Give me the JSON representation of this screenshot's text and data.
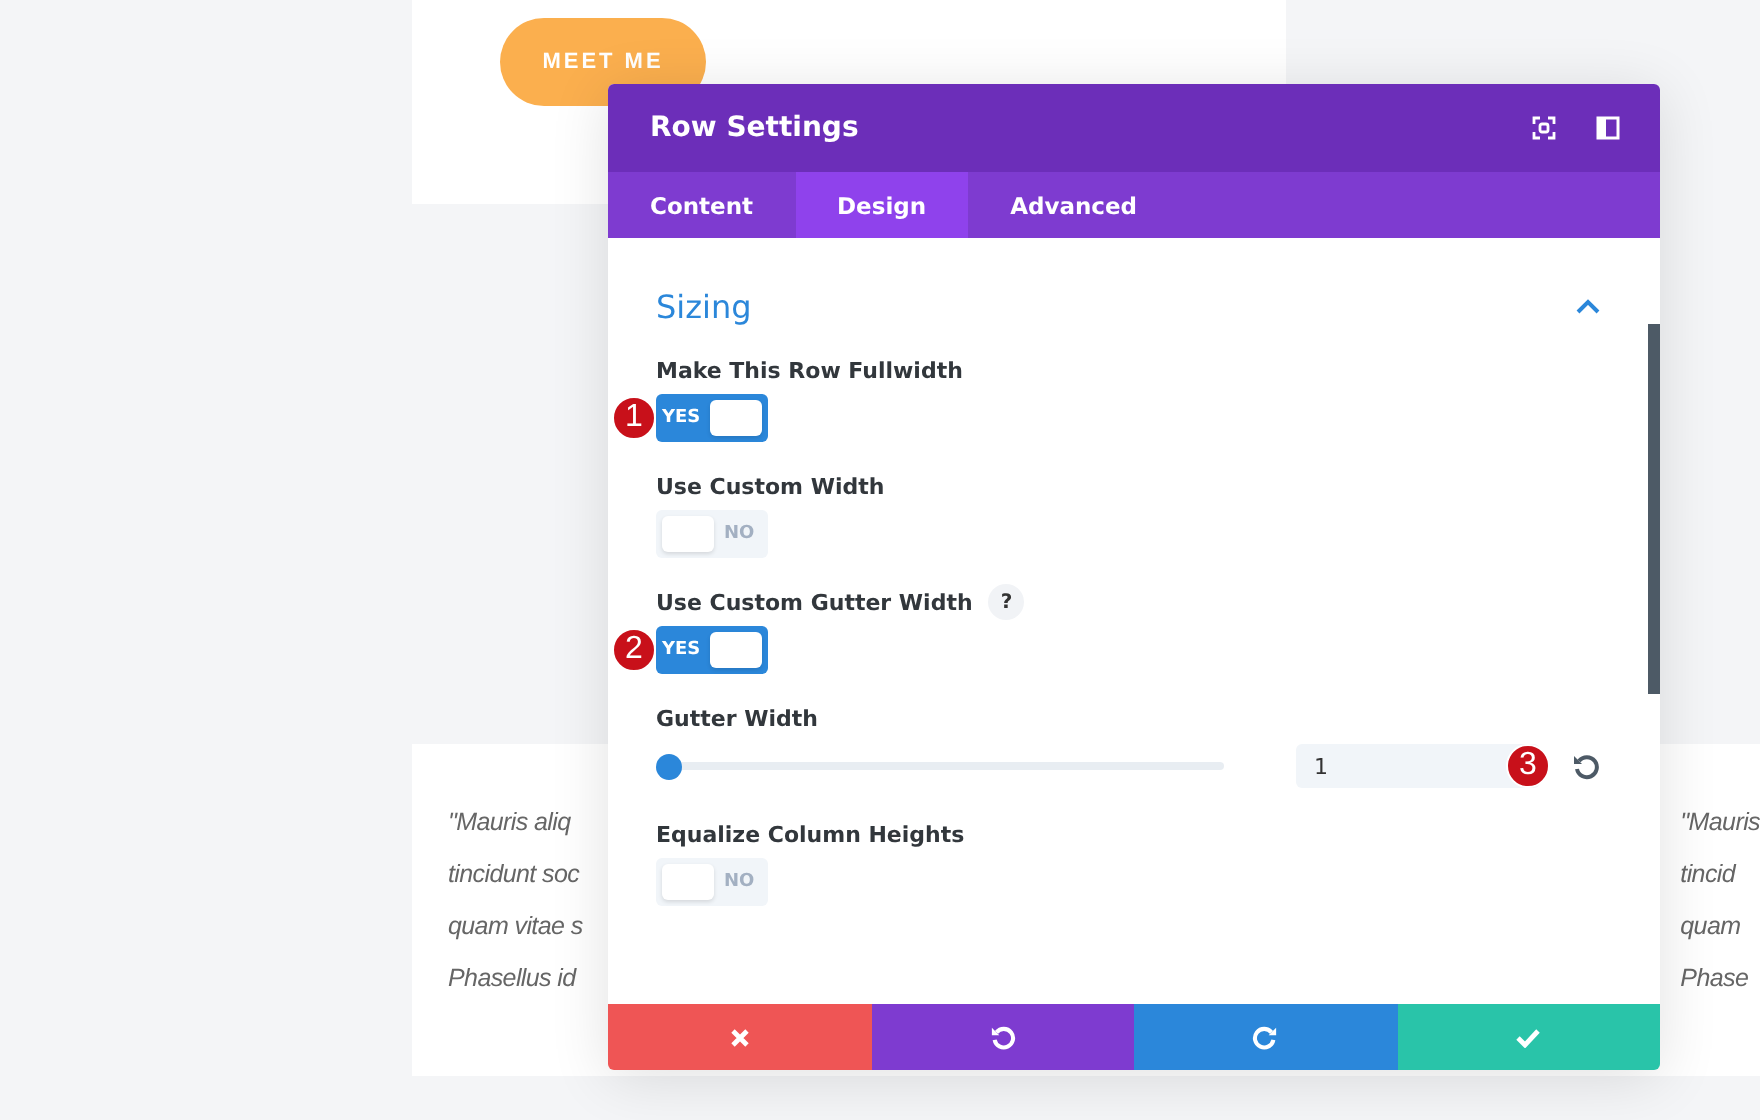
{
  "page": {
    "button": "MEET ME",
    "quote_left": [
      "\"Mauris aliq",
      "tincidunt soc",
      "quam vitae s",
      "Phasellus id"
    ],
    "quote_right": [
      "\"Mauris",
      "tincid",
      "quam",
      "Phase"
    ]
  },
  "modal": {
    "title": "Row Settings",
    "tabs": [
      {
        "label": "Content",
        "selected": false
      },
      {
        "label": "Design",
        "selected": true
      },
      {
        "label": "Advanced",
        "selected": false
      }
    ],
    "section": {
      "title": "Sizing",
      "expanded": true
    },
    "settings": [
      {
        "kind": "toggle",
        "label": "Make This Row Fullwidth",
        "on": true,
        "text": "YES",
        "marker": "1"
      },
      {
        "kind": "toggle",
        "label": "Use Custom Width",
        "on": false,
        "text": "NO"
      },
      {
        "kind": "toggle",
        "label": "Use Custom Gutter Width",
        "help": "?",
        "on": true,
        "text": "YES",
        "marker": "2"
      },
      {
        "kind": "slider",
        "label": "Gutter Width",
        "level": 0,
        "value": "1",
        "marker": "3"
      },
      {
        "kind": "toggle",
        "label": "Equalize Column Heights",
        "on": false,
        "text": "NO"
      }
    ],
    "footer": [
      {
        "kind": "cancel"
      },
      {
        "kind": "undo"
      },
      {
        "kind": "redo"
      },
      {
        "kind": "save"
      }
    ]
  }
}
